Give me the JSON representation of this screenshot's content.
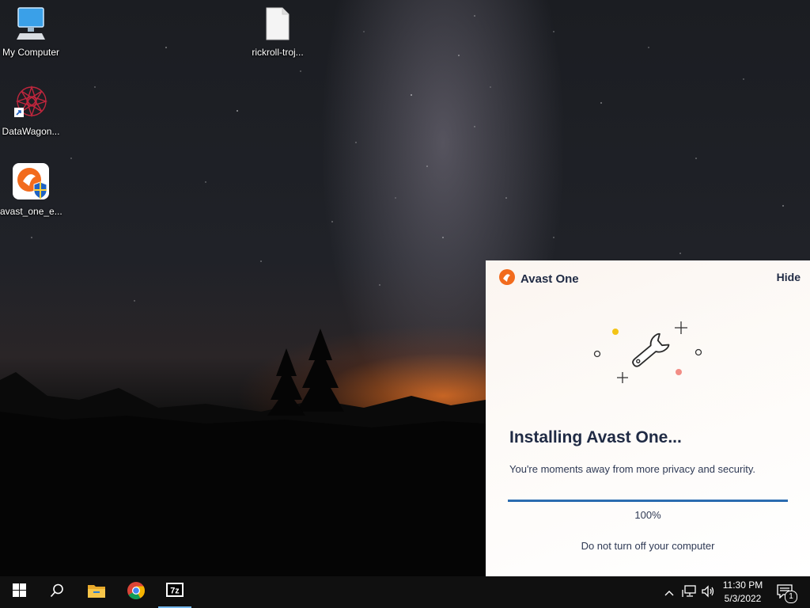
{
  "desktop": {
    "icons": [
      {
        "label": "My Computer",
        "icon": "computer-icon"
      },
      {
        "label": "rickroll-troj...",
        "icon": "file-icon"
      },
      {
        "label": "DataWagon...",
        "icon": "datawagon-icon"
      },
      {
        "label": "avast_one_e...",
        "icon": "avast-installer-icon"
      }
    ]
  },
  "avast": {
    "app_name": "Avast One",
    "hide_label": "Hide",
    "heading": "Installing Avast One...",
    "subtext": "You're moments away from more privacy and security.",
    "progress": 1.0,
    "progress_label": "100%",
    "warning": "Do not turn off your computer",
    "colors": {
      "brand": "#f26b1d",
      "progress": "#2b6cb0",
      "text": "#1f2a44"
    }
  },
  "taskbar": {
    "buttons": [
      "start-icon",
      "search-icon",
      "file-explorer-icon",
      "chrome-icon",
      "7zip-icon"
    ],
    "tray_icons": [
      "chevron-up-icon",
      "network-icon",
      "volume-icon"
    ],
    "time": "11:30 PM",
    "date": "5/3/2022",
    "notification_count": "1"
  }
}
